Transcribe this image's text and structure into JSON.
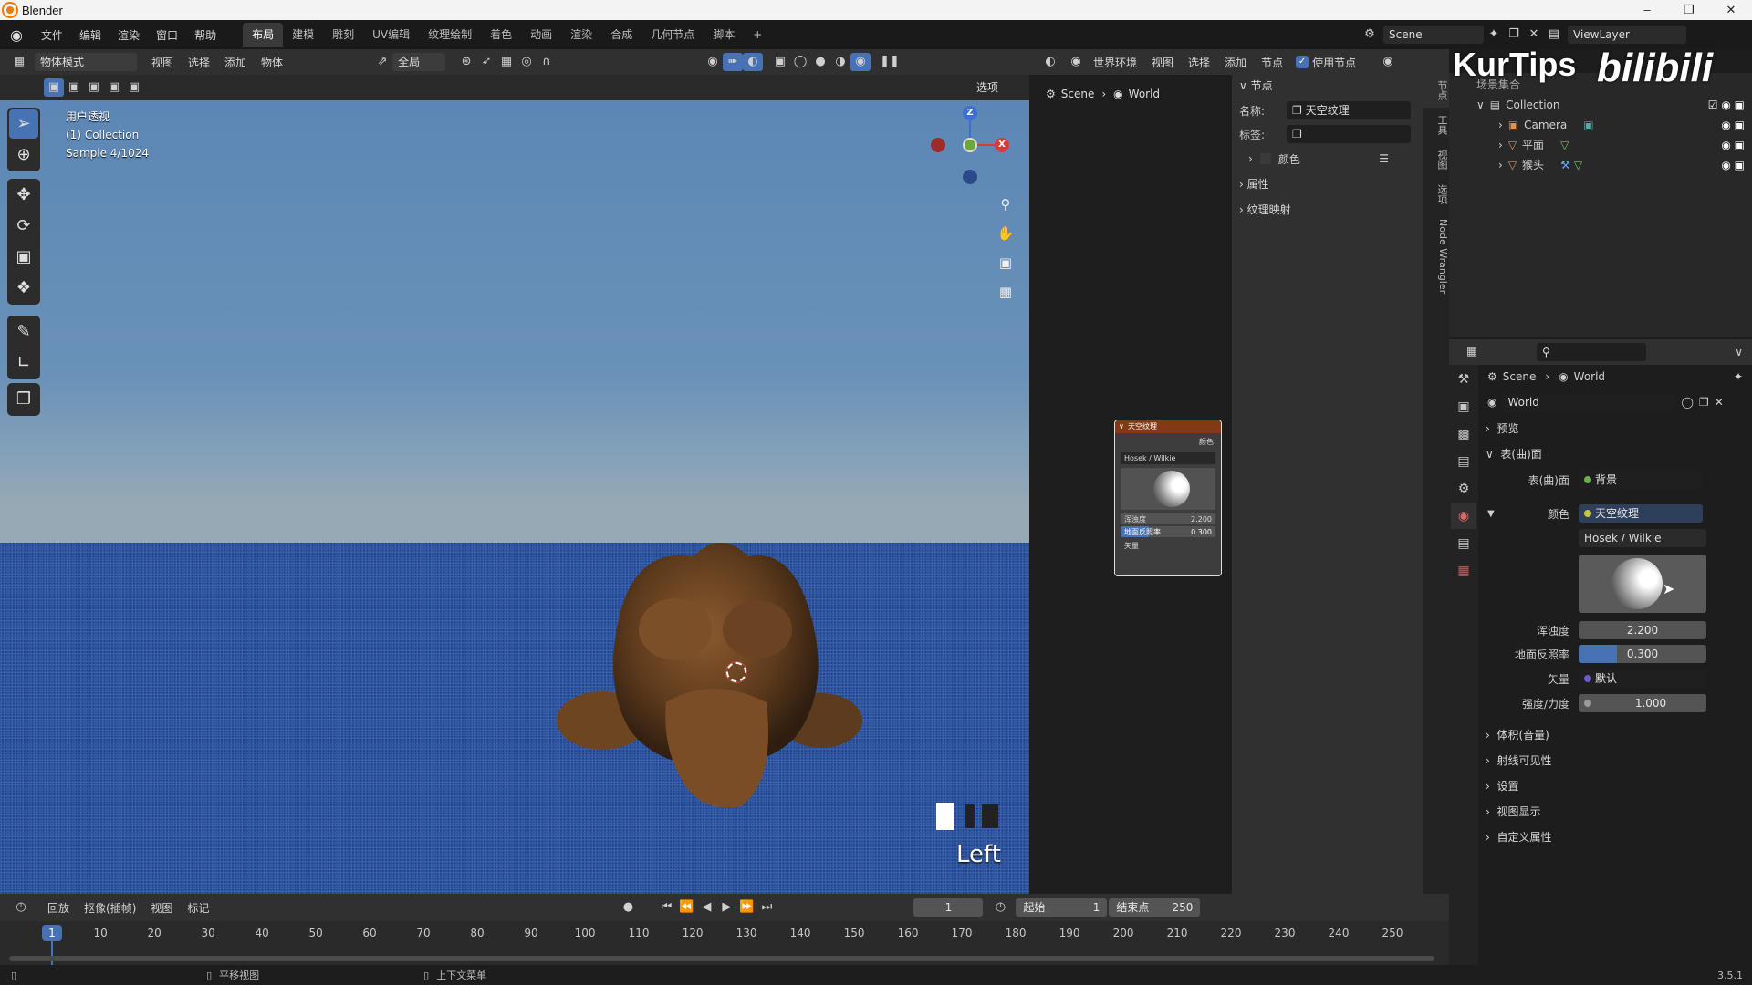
{
  "title_bar": {
    "app_name": "Blender"
  },
  "menu": [
    "文件",
    "编辑",
    "渲染",
    "窗口",
    "帮助"
  ],
  "workspaces": [
    "布局",
    "建模",
    "雕刻",
    "UV编辑",
    "纹理绘制",
    "着色",
    "动画",
    "渲染",
    "合成",
    "几何节点",
    "脚本"
  ],
  "workspace_add": "+",
  "scene_selector": "Scene",
  "viewlayer_selector": "ViewLayer",
  "watermark": {
    "left": "KurTips",
    "right": "bilibili"
  },
  "viewport_header": {
    "mode": "物体模式",
    "menus": [
      "视图",
      "选择",
      "添加",
      "物体"
    ],
    "transform_orientation": "全局",
    "options_label": "选项"
  },
  "viewport": {
    "perspective": "用户透视",
    "collection": "(1) Collection",
    "sample": "Sample 4/1024",
    "camera_label": "Left",
    "gizmo": {
      "z": "Z",
      "x": "X"
    }
  },
  "node_header": {
    "world_type": "世界环境",
    "menus": [
      "视图",
      "选择",
      "添加",
      "节点"
    ],
    "use_nodes_label": "使用节点"
  },
  "node_breadcrumb": {
    "scene": "Scene",
    "world": "World"
  },
  "n_panel": {
    "node_section": "节点",
    "name_label": "名称:",
    "name_value": "天空纹理",
    "label_label": "标签:",
    "label_value": "",
    "color_label": "颜色",
    "properties_section": "属性",
    "texture_mapping_section": "纹理映射"
  },
  "side_tabs": [
    "节点",
    "工具",
    "视图",
    "选项",
    "Node Wrangler"
  ],
  "sky_node": {
    "title": "天空纹理",
    "output": "颜色",
    "model": "Hosek / Wilkie",
    "turbidity_label": "浑浊度",
    "turbidity": "2.200",
    "albedo_label": "地面反照率",
    "albedo": "0.300",
    "vector_label": "矢量"
  },
  "outliner": {
    "root": "场景集合",
    "items": [
      {
        "name": "Collection"
      },
      {
        "name": "Camera"
      },
      {
        "name": "平面"
      },
      {
        "name": "猴头"
      }
    ]
  },
  "properties": {
    "breadcrumb": {
      "scene": "Scene",
      "world": "World"
    },
    "world_name": "World",
    "sections": {
      "preview": "预览",
      "surface": "表(曲)面",
      "volume": "体积(音量)",
      "ray_visibility": "射线可见性",
      "settings": "设置",
      "viewport_display": "视图显示",
      "custom_props": "自定义属性"
    },
    "surface_label": "表(曲)面",
    "surface_value": "背景",
    "color_label": "颜色",
    "color_value": "天空纹理",
    "model": "Hosek / Wilkie",
    "turbidity_label": "浑浊度",
    "turbidity": "2.200",
    "albedo_label": "地面反照率",
    "albedo": "0.300",
    "albedo_fraction": 0.3,
    "vector_label": "矢量",
    "vector_value": "默认",
    "strength_label": "强度/力度",
    "strength": "1.000"
  },
  "timeline": {
    "menus": [
      "回放",
      "抠像(插帧)",
      "视图",
      "标记"
    ],
    "current_frame": "1",
    "start_label": "起始",
    "start": "1",
    "end_label": "结束点",
    "end": "250",
    "ticks": [
      "1",
      "10",
      "20",
      "30",
      "40",
      "50",
      "60",
      "70",
      "80",
      "90",
      "100",
      "110",
      "120",
      "130",
      "140",
      "150",
      "160",
      "170",
      "180",
      "190",
      "200",
      "210",
      "220",
      "230",
      "240",
      "250"
    ]
  },
  "status_bar": {
    "pan": "平移视图",
    "context": "上下文菜单",
    "version": "3.5.1"
  },
  "colors": {
    "accent": "#4772b3",
    "node_header": "#813a13",
    "ground": "#2a52a0"
  }
}
